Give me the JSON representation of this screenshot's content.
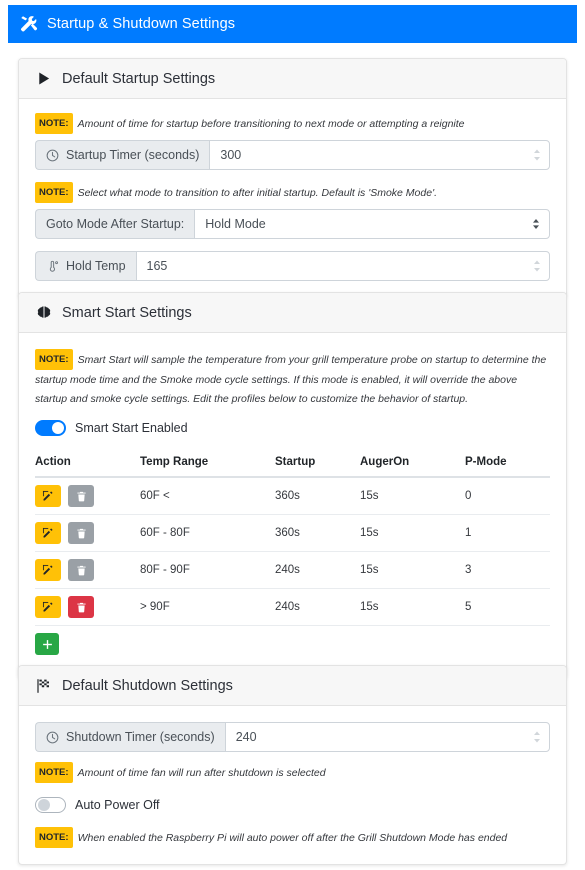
{
  "header": {
    "title": "Startup & Shutdown Settings",
    "icon": "tools-icon",
    "bg_color": "#007bff",
    "text_color": "#ffffff"
  },
  "startup_section": {
    "title": "Default Startup Settings",
    "icon": "play-triangle-icon",
    "note_timer": "Amount of time for startup before transitioning to next mode or attempting a reignite",
    "note_label": "NOTE:",
    "timer_label": "Startup Timer (seconds)",
    "timer_icon": "clock-icon",
    "timer_value": "300",
    "note_mode": "Select what mode to transition to after initial startup. Default is 'Smoke Mode'.",
    "goto_mode_label": "Goto Mode After Startup:",
    "goto_mode_value": "Hold Mode",
    "hold_temp_label": "Hold Temp",
    "hold_temp_icon": "thermometer-icon",
    "hold_temp_value": "165"
  },
  "smart_start_section": {
    "title": "Smart Start Settings",
    "icon": "brain-icon",
    "note_label": "NOTE:",
    "note": "Smart Start will sample the temperature from your grill temperature probe on startup to determine the startup mode time and the Smoke mode cycle settings. If this mode is enabled, it will override the above startup and smoke cycle settings. Edit the profiles below to customize the behavior of startup.",
    "toggle_label": "Smart Start Enabled",
    "toggle_state": "on",
    "toggle_on_color": "#007bff",
    "table": {
      "columns": [
        "Action",
        "Temp Range",
        "Startup",
        "AugerOn",
        "P-Mode"
      ],
      "rows": [
        {
          "temp_range": "60F <",
          "startup": "360s",
          "auger_on": "15s",
          "p_mode": "0",
          "delete_enabled": false
        },
        {
          "temp_range": "60F - 80F",
          "startup": "360s",
          "auger_on": "15s",
          "p_mode": "1",
          "delete_enabled": false
        },
        {
          "temp_range": "80F - 90F",
          "startup": "240s",
          "auger_on": "15s",
          "p_mode": "3",
          "delete_enabled": false
        },
        {
          "temp_range": "> 90F",
          "startup": "240s",
          "auger_on": "15s",
          "p_mode": "5",
          "delete_enabled": true
        }
      ],
      "edit_icon": "edit-pencil-icon",
      "delete_icon": "trash-icon",
      "add_icon": "plus-icon",
      "edit_color": "#ffc107",
      "delete_color": "#dc3545",
      "delete_disabled_color": "#9aa0a6",
      "add_color": "#28a745"
    }
  },
  "shutdown_section": {
    "title": "Default Shutdown Settings",
    "icon": "checkered-flag-icon",
    "timer_label": "Shutdown Timer (seconds)",
    "timer_icon": "clock-icon",
    "timer_value": "240",
    "note_label": "NOTE:",
    "note_timer": "Amount of time fan will run after shutdown is selected",
    "auto_power_off_label": "Auto Power Off",
    "auto_power_off_state": "off",
    "note_auto_power": "When enabled the Raspberry Pi will auto power off after the Grill Shutdown Mode has ended"
  }
}
